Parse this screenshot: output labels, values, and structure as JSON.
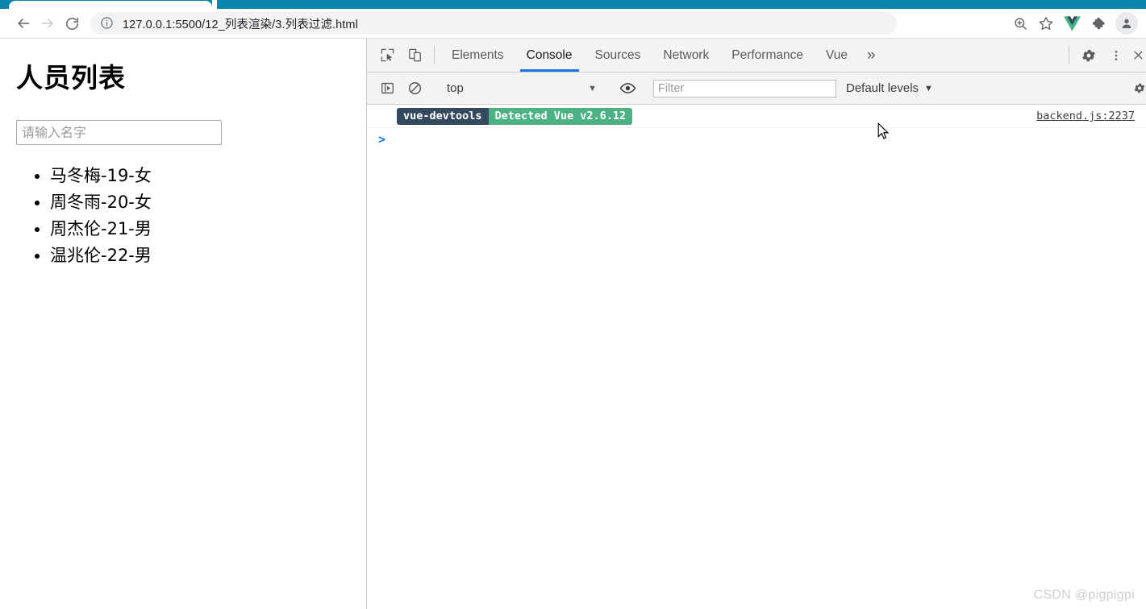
{
  "browser": {
    "tab_strip_color": "#0A86AD",
    "nav": {
      "back_label": "Back",
      "forward_label": "Forward",
      "reload_label": "Reload"
    },
    "omnibox": {
      "site_info_icon": "info-circle-icon",
      "url": "127.0.0.1:5500/12_列表渲染/3.列表过滤.html"
    },
    "toolbar_icons": [
      {
        "name": "zoom-icon",
        "glyph": "zoom"
      },
      {
        "name": "bookmark-star-icon",
        "glyph": "star"
      },
      {
        "name": "vue-devtools-extension-icon",
        "glyph": "vue",
        "color": "#41b883"
      },
      {
        "name": "extensions-puzzle-icon",
        "glyph": "puzzle"
      },
      {
        "name": "profile-avatar-icon",
        "glyph": "person"
      }
    ]
  },
  "page": {
    "title": "人员列表",
    "search": {
      "placeholder": "请输入名字",
      "value": ""
    },
    "people": [
      "马冬梅-19-女",
      "周冬雨-20-女",
      "周杰伦-21-男",
      "温兆伦-22-男"
    ]
  },
  "devtools": {
    "left_icons": [
      {
        "name": "inspect-element-icon",
        "title": "Inspect"
      },
      {
        "name": "device-toolbar-icon",
        "title": "Toggle device toolbar"
      }
    ],
    "tabs": [
      {
        "label": "Elements",
        "active": false
      },
      {
        "label": "Console",
        "active": true
      },
      {
        "label": "Sources",
        "active": false
      },
      {
        "label": "Network",
        "active": false
      },
      {
        "label": "Performance",
        "active": false
      },
      {
        "label": "Vue",
        "active": false
      }
    ],
    "more_tabs_label": "»",
    "right_icons": [
      {
        "name": "settings-gear-icon"
      },
      {
        "name": "more-options-kebab-icon"
      },
      {
        "name": "close-devtools-icon"
      }
    ],
    "filterbar": {
      "sidebar_toggle_icon": "console-sidebar-icon",
      "clear_console_icon": "clear-console-icon",
      "context": "top",
      "context_caret": "▼",
      "eye_icon": "live-expression-eye-icon",
      "filter_placeholder": "Filter",
      "filter_value": "",
      "levels_label": "Default levels",
      "levels_caret": "▼",
      "settings_icon": "console-settings-icon"
    },
    "console": {
      "messages": [
        {
          "badge_left": "vue-devtools",
          "badge_right": "Detected Vue v2.6.12",
          "badge_left_color": "#35495e",
          "badge_right_color": "#4cb184",
          "source": "backend.js:2237"
        }
      ],
      "prompt": ">"
    }
  },
  "watermark": "CSDN @pigpigpi"
}
